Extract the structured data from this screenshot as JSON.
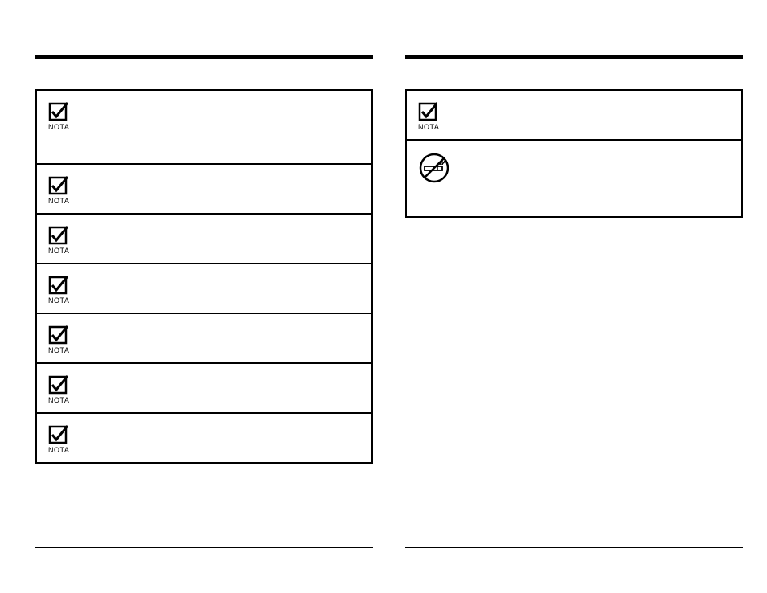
{
  "icons": {
    "checkbox_label": "NOTA"
  },
  "left_column": {
    "items": [
      {
        "type": "nota",
        "text": ""
      },
      {
        "type": "nota",
        "text": ""
      },
      {
        "type": "nota",
        "text": ""
      },
      {
        "type": "nota",
        "text": ""
      },
      {
        "type": "nota",
        "text": ""
      },
      {
        "type": "nota",
        "text": ""
      },
      {
        "type": "nota",
        "text": ""
      }
    ]
  },
  "right_column": {
    "items": [
      {
        "type": "nota",
        "text": ""
      },
      {
        "type": "nosmoke",
        "text": ""
      }
    ]
  }
}
